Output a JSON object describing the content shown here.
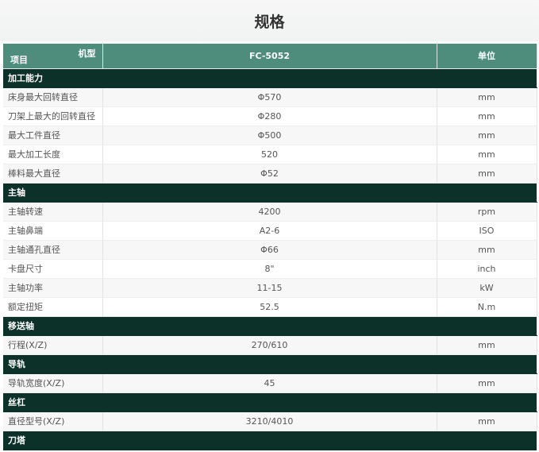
{
  "title": "规格",
  "header": {
    "model_label": "机型",
    "item_label": "项目",
    "model_value": "FC-5052",
    "unit_label": "单位"
  },
  "sections": [
    {
      "name": "加工能力",
      "rows": [
        {
          "label": "床身最大回转直径",
          "value": "Φ570",
          "unit": "mm"
        },
        {
          "label": "刀架上最大的回转直径",
          "value": "Φ280",
          "unit": "mm"
        },
        {
          "label": "最大工件直径",
          "value": "Φ500",
          "unit": "mm"
        },
        {
          "label": "最大加工长度",
          "value": "520",
          "unit": "mm"
        },
        {
          "label": "棒料最大直径",
          "value": "Φ52",
          "unit": "mm"
        }
      ]
    },
    {
      "name": "主轴",
      "rows": [
        {
          "label": "主轴转速",
          "value": "4200",
          "unit": "rpm"
        },
        {
          "label": "主轴鼻端",
          "value": "A2-6",
          "unit": "ISO"
        },
        {
          "label": "主轴通孔直径",
          "value": "Φ66",
          "unit": "mm"
        },
        {
          "label": "卡盘尺寸",
          "value": "8\"",
          "unit": "inch"
        },
        {
          "label": "主轴功率",
          "value": "11-15",
          "unit": "kW"
        },
        {
          "label": "额定扭矩",
          "value": "52.5",
          "unit": "N.m"
        }
      ]
    },
    {
      "name": "移送轴",
      "rows": [
        {
          "label": "行程(X/Z)",
          "value": "270/610",
          "unit": "mm"
        }
      ]
    },
    {
      "name": "导轨",
      "rows": [
        {
          "label": "导轨宽度(X/Z)",
          "value": "45",
          "unit": "mm"
        }
      ]
    },
    {
      "name": "丝杠",
      "rows": [
        {
          "label": "直径型号(X/Z)",
          "value": "3210/4010",
          "unit": "mm"
        }
      ]
    },
    {
      "name": "刀塔",
      "rows": []
    }
  ],
  "colors": {
    "header_bg": "#4e8c7c",
    "section_bg": "#0c3129",
    "stripe_bg": "#f7f7f7"
  }
}
